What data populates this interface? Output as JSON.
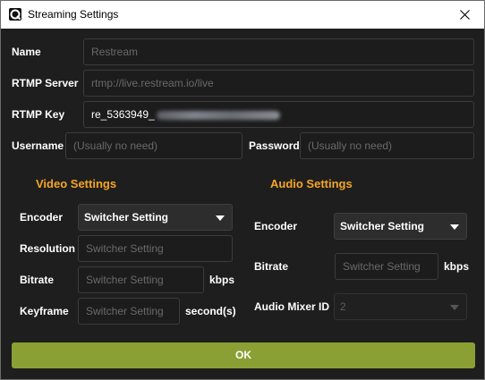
{
  "window": {
    "title": "Streaming Settings"
  },
  "fields": {
    "name": {
      "label": "Name",
      "placeholder": "Restream"
    },
    "rtmp_server": {
      "label": "RTMP Server",
      "placeholder": "rtmp://live.restream.io/live"
    },
    "rtmp_key": {
      "label": "RTMP Key",
      "value": "re_5363949_"
    },
    "username": {
      "label": "Username",
      "placeholder": "(Usually no need)"
    },
    "password": {
      "label": "Password",
      "placeholder": "(Usually no need)"
    }
  },
  "video": {
    "heading": "Video Settings",
    "encoder": {
      "label": "Encoder",
      "value": "Switcher Setting"
    },
    "resolution": {
      "label": "Resolution",
      "placeholder": "Switcher Setting"
    },
    "bitrate": {
      "label": "Bitrate",
      "placeholder": "Switcher Setting",
      "unit": "kbps"
    },
    "keyframe": {
      "label": "Keyframe",
      "placeholder": "Switcher Setting",
      "unit": "second(s)"
    }
  },
  "audio": {
    "heading": "Audio Settings",
    "encoder": {
      "label": "Encoder",
      "value": "Switcher Setting"
    },
    "bitrate": {
      "label": "Bitrate",
      "placeholder": "Switcher Setting",
      "unit": "kbps"
    },
    "mixer": {
      "label": "Audio Mixer ID",
      "value": "2"
    }
  },
  "ok_label": "OK",
  "icons": {
    "app": "app-logo-icon",
    "close": "close-icon",
    "dropdown": "chevron-down-icon"
  },
  "colors": {
    "section_heading": "#f5a623",
    "ok_button": "#8aa034",
    "background": "#1e1e1e"
  }
}
